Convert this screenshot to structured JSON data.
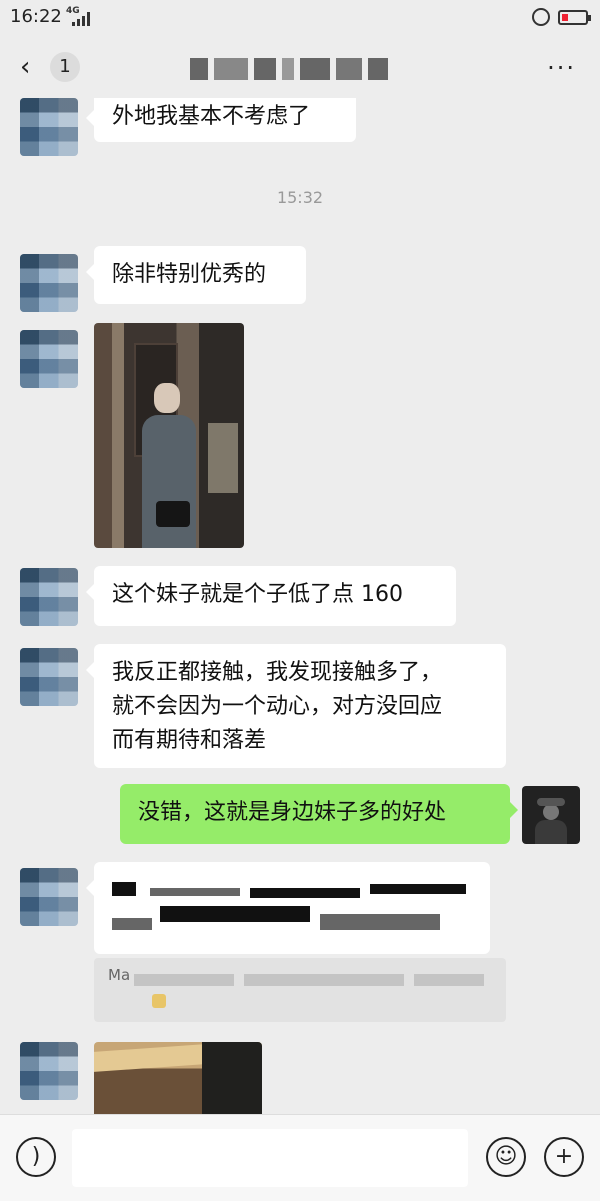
{
  "status_bar": {
    "time": "16:22",
    "network": "4G"
  },
  "header": {
    "unread_count": "1",
    "title": ""
  },
  "messages": [
    {
      "side": "left",
      "text": "外地我基本不考虑了"
    },
    {
      "side": "timestamp",
      "text": "15:32"
    },
    {
      "side": "left",
      "text": "除非特别优秀的"
    },
    {
      "side": "left",
      "type": "image"
    },
    {
      "side": "left",
      "text": "这个妹子就是个子低了点 160"
    },
    {
      "side": "left",
      "text": "我反正都接触，我发现接触多了，\n就不会因为一个动心，对方没回应\n而有期待和落差"
    },
    {
      "side": "right",
      "text": "没错，这就是身边妹子多的好处"
    },
    {
      "side": "left",
      "text": ""
    },
    {
      "side": "quote",
      "text": "Ma"
    },
    {
      "side": "left",
      "type": "image"
    }
  ],
  "input": {
    "placeholder": ""
  },
  "icons": {
    "voice": "voice-icon",
    "emoji": "emoji-icon",
    "more": "plus-icon"
  }
}
